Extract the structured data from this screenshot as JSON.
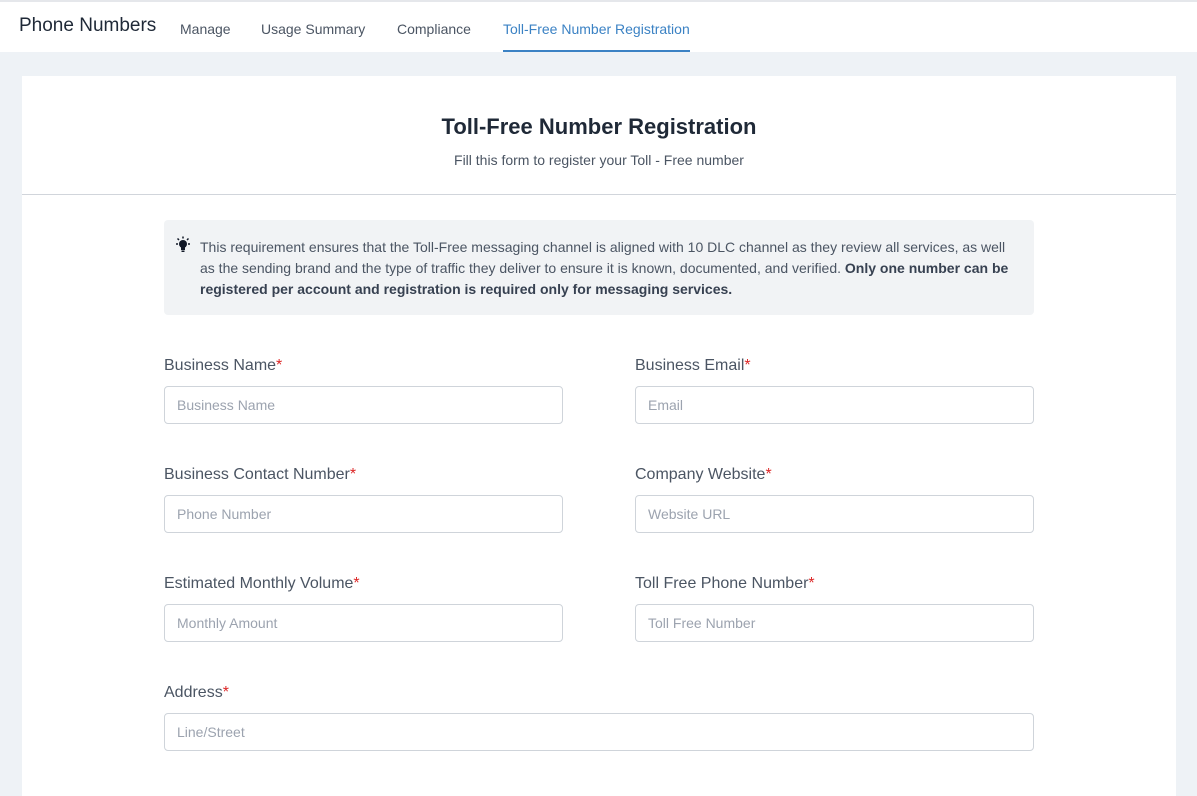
{
  "header": {
    "app_title": "Phone Numbers",
    "tabs": [
      {
        "label": "Manage"
      },
      {
        "label": "Usage Summary"
      },
      {
        "label": "Compliance"
      },
      {
        "label": "Toll-Free Number Registration",
        "active": true
      }
    ]
  },
  "form": {
    "title": "Toll-Free Number Registration",
    "subtitle": "Fill this form to register your Toll - Free number",
    "notice": {
      "icon": "lightbulb-icon",
      "text": "This requirement ensures that the Toll-Free messaging channel is aligned with 10 DLC channel as they review all services, as well as the sending brand and the type of traffic they deliver to ensure it is known, documented, and verified. ",
      "bold_text": "Only one number can be registered per account and registration is required only for messaging services."
    },
    "required_marker": "*",
    "fields": {
      "business_name": {
        "label": "Business Name",
        "placeholder": "Business Name",
        "value": ""
      },
      "business_email": {
        "label": "Business Email",
        "placeholder": "Email",
        "value": ""
      },
      "contact_number": {
        "label": "Business Contact Number",
        "placeholder": "Phone Number",
        "value": ""
      },
      "company_website": {
        "label": "Company Website",
        "placeholder": "Website URL",
        "value": ""
      },
      "monthly_volume": {
        "label": "Estimated Monthly Volume",
        "placeholder": "Monthly Amount",
        "value": ""
      },
      "toll_free_number": {
        "label": "Toll Free Phone Number",
        "placeholder": "Toll Free Number",
        "value": ""
      },
      "address": {
        "label": "Address",
        "placeholder": "Line/Street",
        "value": ""
      }
    }
  },
  "colors": {
    "accent": "#3b82c4",
    "required": "#dc2626",
    "background": "#eef2f6",
    "notice_bg": "#f1f3f5"
  }
}
